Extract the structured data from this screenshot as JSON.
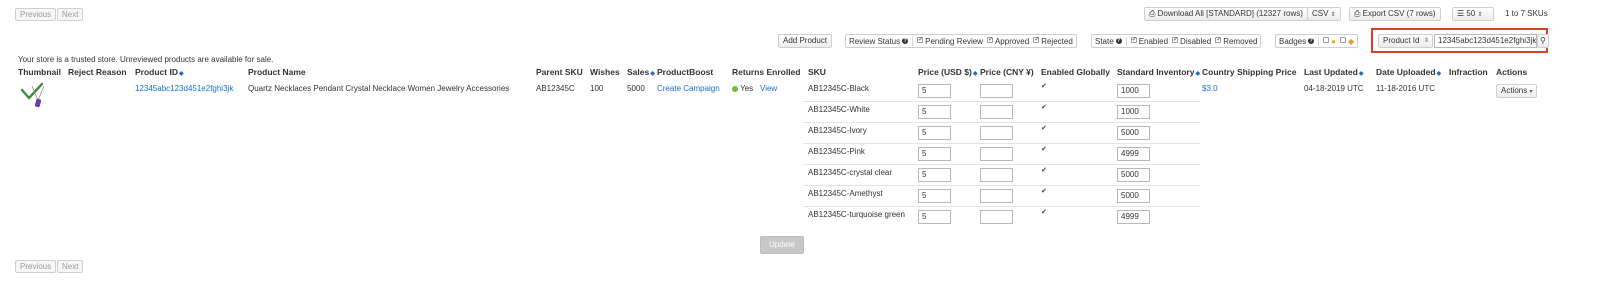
{
  "pager": {
    "previous": "Previous",
    "next": "Next"
  },
  "toolbar": {
    "download_all": "Download All [STANDARD] (12327 rows)",
    "format": "CSV",
    "export_csv": "Export CSV (7 rows)",
    "page_size": "50",
    "range": "1 to 7 SKUs",
    "add_product": "Add Product",
    "review_status_label": "Review Status",
    "review_options": [
      "Pending Review",
      "Approved",
      "Rejected"
    ],
    "state_label": "State",
    "state_options": [
      "Enabled",
      "Disabled",
      "Removed"
    ],
    "badges_label": "Badges",
    "search_field": "Product Id",
    "search_value": "12345abc123d451e2fghi3jk"
  },
  "notice": "Your store is a trusted store. Unreviewed products are available for sale.",
  "columns": {
    "thumbnail": "Thumbnail",
    "reject_reason": "Reject Reason",
    "product_id": "Product ID",
    "product_name": "Product Name",
    "parent_sku": "Parent SKU",
    "wishes": "Wishes",
    "sales": "Sales",
    "productboost": "ProductBoost",
    "returns_enrolled": "Returns Enrolled",
    "sku": "SKU",
    "price_usd": "Price (USD $)",
    "price_cny": "Price (CNY ¥)",
    "enabled_globally": "Enabled Globally",
    "standard_inventory": "Standard Inventory",
    "country_shipping_price": "Country Shipping Price",
    "last_updated": "Last Updated",
    "date_uploaded": "Date Uploaded",
    "infraction": "Infraction",
    "actions": "Actions"
  },
  "product": {
    "product_id": "12345abc123d451e2fghi3jk",
    "name": "Quartz Necklaces Pendant Crystal Necklace Women Jewelry Accessories",
    "parent_sku": "AB12345C",
    "wishes": "100",
    "sales": "5000",
    "productboost": "Create Campaign",
    "returns_enrolled": "Yes",
    "returns_view": "View",
    "country_shipping_price": "$3.0",
    "last_updated": "04-18-2019 UTC",
    "date_uploaded": "11-18-2016 UTC",
    "actions": "Actions"
  },
  "variants": [
    {
      "sku": "AB12345C-Black",
      "price_usd": "5",
      "price_cny": "",
      "inventory": "1000"
    },
    {
      "sku": "AB12345C-White",
      "price_usd": "5",
      "price_cny": "",
      "inventory": "1000"
    },
    {
      "sku": "AB12345C-Ivory",
      "price_usd": "5",
      "price_cny": "",
      "inventory": "5000"
    },
    {
      "sku": "AB12345C-Pink",
      "price_usd": "5",
      "price_cny": "",
      "inventory": "4999"
    },
    {
      "sku": "AB12345C-crystal clear",
      "price_usd": "5",
      "price_cny": "",
      "inventory": "5000"
    },
    {
      "sku": "AB12345C-Amethyst",
      "price_usd": "5",
      "price_cny": "",
      "inventory": "5000"
    },
    {
      "sku": "AB12345C-turquoise green",
      "price_usd": "5",
      "price_cny": "",
      "inventory": "4999"
    }
  ],
  "update_button": "Update",
  "colors": {
    "link": "#1a6fc7",
    "highlight": "#d9402b",
    "status_green": "#6cbf3a"
  }
}
